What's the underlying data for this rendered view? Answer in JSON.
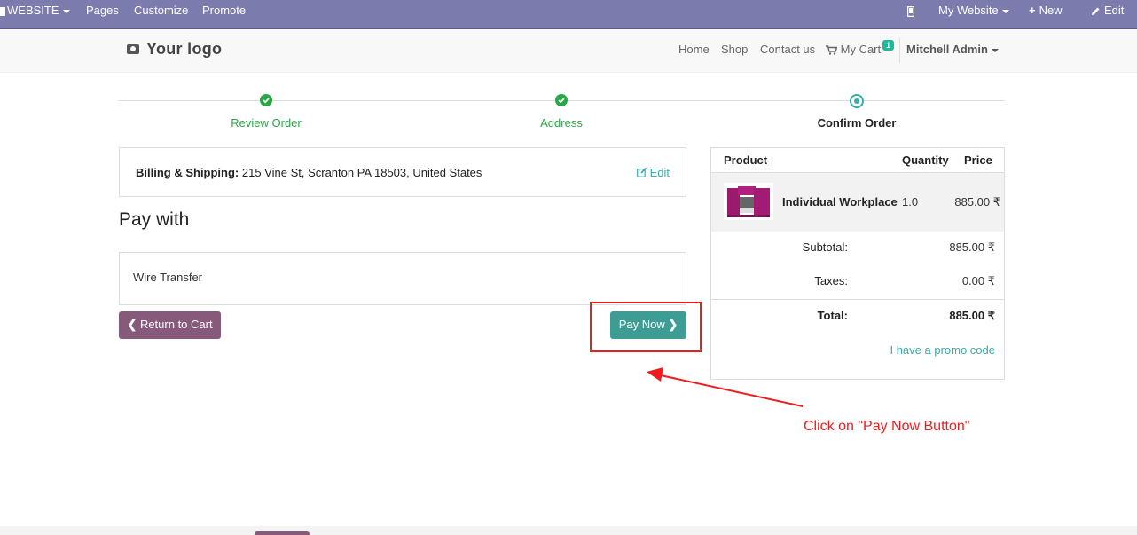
{
  "adminbar": {
    "website": "WEBSITE",
    "pages": "Pages",
    "customize": "Customize",
    "promote": "Promote",
    "my_website": "My Website",
    "new": "New",
    "edit": "Edit"
  },
  "header": {
    "logo": "Your logo",
    "nav": [
      "Home",
      "Shop",
      "Contact us"
    ],
    "cart_label": "My Cart",
    "cart_count": "1",
    "user": "Mitchell Admin"
  },
  "wizard": {
    "steps": [
      "Review Order",
      "Address",
      "Confirm Order"
    ],
    "current_step": 3
  },
  "billing": {
    "label": "Billing & Shipping:",
    "address": " 215 Vine St, Scranton PA 18503, United States",
    "edit": "Edit"
  },
  "payment": {
    "heading": "Pay with",
    "method": "Wire Transfer",
    "return_label": "Return to Cart",
    "pay_label": "Pay Now"
  },
  "summary": {
    "headers": [
      "Product",
      "Quantity",
      "Price"
    ],
    "product": {
      "name": "Individual Workplace",
      "qty": "1.0",
      "price": "885.00 ₹"
    },
    "subtotal_label": "Subtotal:",
    "subtotal": "885.00 ₹",
    "taxes_label": "Taxes:",
    "taxes": "0.00 ₹",
    "total_label": "Total:",
    "total": "885.00 ₹",
    "promo": "I have a promo code"
  },
  "annotation": {
    "text": "Click on \"Pay Now Button\""
  },
  "colors": {
    "adminbar": "#7c7bad",
    "primary": "#875a7b",
    "accent": "#3aadaa",
    "success": "#28a745",
    "annotation": "#ee1c1c"
  }
}
